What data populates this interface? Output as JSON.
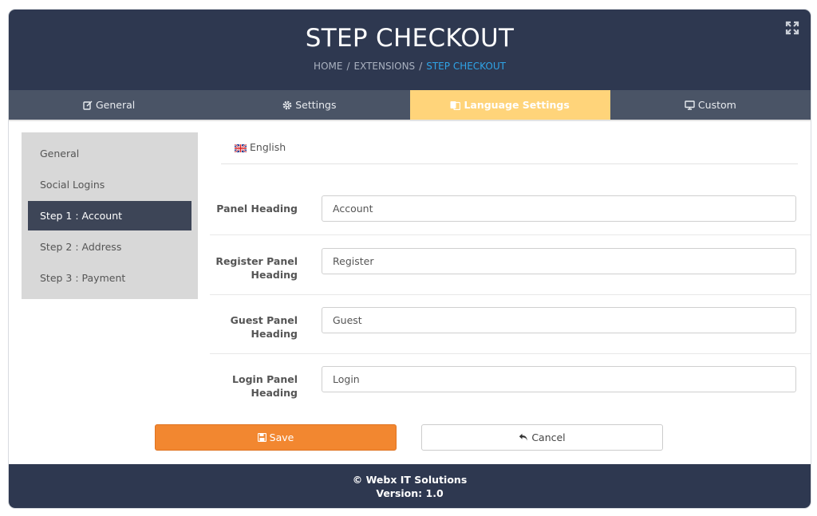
{
  "header": {
    "title": "STEP CHECKOUT",
    "breadcrumb": [
      "HOME",
      "EXTENSIONS",
      "STEP CHECKOUT"
    ],
    "expand_icon": "expand-icon"
  },
  "tabs": [
    {
      "label": "General",
      "icon": "edit-icon"
    },
    {
      "label": "Settings",
      "icon": "gear-icon"
    },
    {
      "label": "Language Settings",
      "icon": "language-icon",
      "active": true
    },
    {
      "label": "Custom",
      "icon": "desktop-icon"
    }
  ],
  "sidebar": {
    "items": [
      {
        "label": "General"
      },
      {
        "label": "Social Logins"
      },
      {
        "label": "Step 1 : Account",
        "active": true
      },
      {
        "label": "Step 2 : Address"
      },
      {
        "label": "Step 3 : Payment"
      }
    ]
  },
  "language": {
    "label": "English",
    "icon": "uk-flag-icon"
  },
  "form": {
    "fields": [
      {
        "label": "Panel Heading",
        "value": "Account"
      },
      {
        "label": "Register Panel Heading",
        "value": "Register"
      },
      {
        "label": "Guest Panel Heading",
        "value": "Guest"
      },
      {
        "label": "Login Panel Heading",
        "value": "Login"
      }
    ]
  },
  "buttons": {
    "save": "Save",
    "cancel": "Cancel"
  },
  "footer": {
    "copyright": "© Webx IT Solutions",
    "version": "Version: 1.0"
  },
  "colors": {
    "header_bg": "#2e3850",
    "tab_bar_bg": "#4a5466",
    "active_tab": "#ffd47a",
    "breadcrumb_active": "#2fa4e7",
    "save_button": "#f28730",
    "sidebar_bg": "#d8d8d8",
    "sidebar_active": "#3d4557"
  }
}
